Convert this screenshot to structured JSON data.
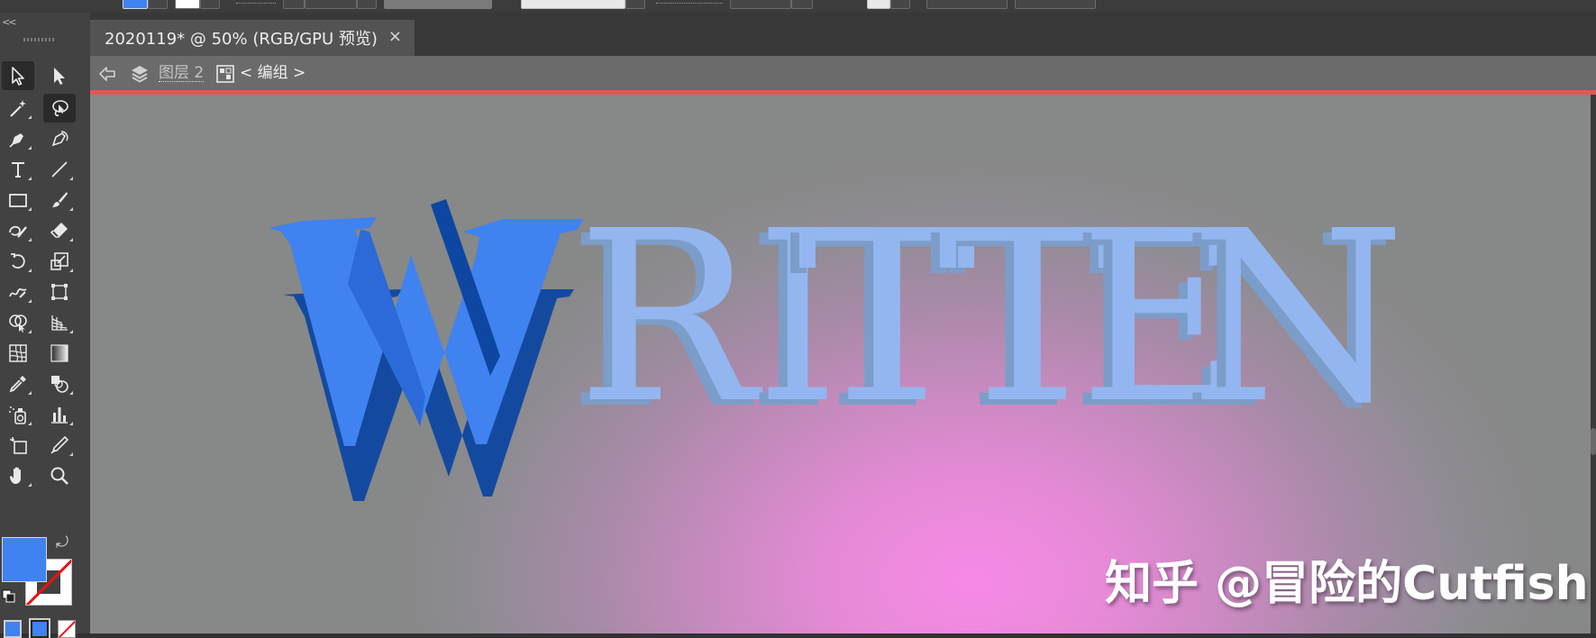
{
  "top_options": {
    "fill_color": "#3f82f0",
    "stroke_color": "none"
  },
  "toolbar": {
    "collapse_label": "<<",
    "tools": [
      {
        "name": "selection-tool",
        "icon": "selection-arrow-icon",
        "active": true
      },
      {
        "name": "direct-selection-tool",
        "icon": "direct-selection-arrow-icon",
        "active": false
      },
      {
        "name": "magic-wand-tool",
        "icon": "magic-wand-icon",
        "active": false
      },
      {
        "name": "lasso-tool",
        "icon": "lasso-icon",
        "active": true
      },
      {
        "name": "pen-tool",
        "icon": "pen-icon",
        "active": false
      },
      {
        "name": "curvature-tool",
        "icon": "curvature-pen-icon",
        "active": false
      },
      {
        "name": "type-tool",
        "icon": "type-icon",
        "active": false
      },
      {
        "name": "line-tool",
        "icon": "line-segment-icon",
        "active": false
      },
      {
        "name": "rectangle-tool",
        "icon": "rectangle-icon",
        "active": false
      },
      {
        "name": "paintbrush-tool",
        "icon": "paintbrush-icon",
        "active": false
      },
      {
        "name": "shaper-tool",
        "icon": "shaper-icon",
        "active": false
      },
      {
        "name": "eraser-tool",
        "icon": "eraser-icon",
        "active": false
      },
      {
        "name": "rotate-tool",
        "icon": "rotate-icon",
        "active": false
      },
      {
        "name": "scale-tool",
        "icon": "scale-icon",
        "active": false
      },
      {
        "name": "warp-tool",
        "icon": "warp-icon",
        "active": false
      },
      {
        "name": "free-transform-tool",
        "icon": "free-transform-icon",
        "active": false
      },
      {
        "name": "shape-builder-tool",
        "icon": "shape-builder-icon",
        "active": false
      },
      {
        "name": "perspective-grid-tool",
        "icon": "perspective-grid-icon",
        "active": false
      },
      {
        "name": "mesh-tool",
        "icon": "mesh-icon",
        "active": false
      },
      {
        "name": "gradient-tool",
        "icon": "gradient-icon",
        "active": false
      },
      {
        "name": "eyedropper-tool",
        "icon": "eyedropper-icon",
        "active": false
      },
      {
        "name": "blend-tool",
        "icon": "blend-icon",
        "active": false
      },
      {
        "name": "symbol-sprayer-tool",
        "icon": "symbol-sprayer-icon",
        "active": false
      },
      {
        "name": "column-graph-tool",
        "icon": "column-graph-icon",
        "active": false
      },
      {
        "name": "artboard-tool",
        "icon": "artboard-icon",
        "active": false
      },
      {
        "name": "slice-tool",
        "icon": "slice-icon",
        "active": false
      },
      {
        "name": "hand-tool",
        "icon": "hand-icon",
        "active": false
      },
      {
        "name": "zoom-tool",
        "icon": "zoom-icon",
        "active": false
      }
    ],
    "fill_color": "#3f82f0",
    "stroke_color": "none"
  },
  "document": {
    "tab_title": "2020119* @ 50% (RGB/GPU 预览)",
    "close_label": "×"
  },
  "isolation": {
    "layer_name": "图层 2",
    "group_label": "< 编组 >",
    "accent_color": "#e65555"
  },
  "artwork": {
    "letters": [
      "W",
      "R",
      "I",
      "T",
      "T",
      "E",
      "N"
    ],
    "w_color": "#3f82f0",
    "w_shadow": "#0d47a1",
    "rest_color": "#94b6f0",
    "rest_shadow": "#7c9dc9"
  },
  "watermark": "知乎 @冒险的Cutfish"
}
